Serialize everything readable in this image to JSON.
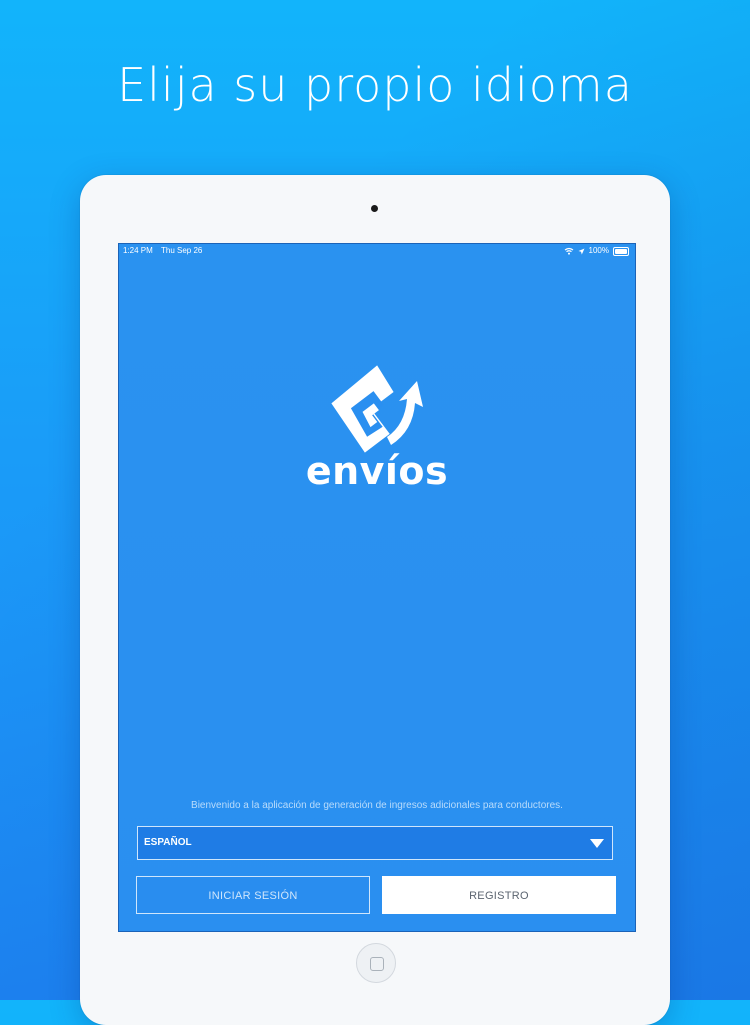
{
  "headline": "Elija su propio idioma",
  "status": {
    "time": "1:24 PM",
    "date": "Thu Sep 26",
    "battery": "100%"
  },
  "brand": {
    "name": "envíos",
    "color": "#2a8ff0"
  },
  "welcome": "Bienvenido a la aplicación de generación de ingresos adicionales para conductores.",
  "language_select": {
    "value": "ESPAÑOL"
  },
  "buttons": {
    "login": "INICIAR SESIÓN",
    "register": "REGISTRO"
  }
}
